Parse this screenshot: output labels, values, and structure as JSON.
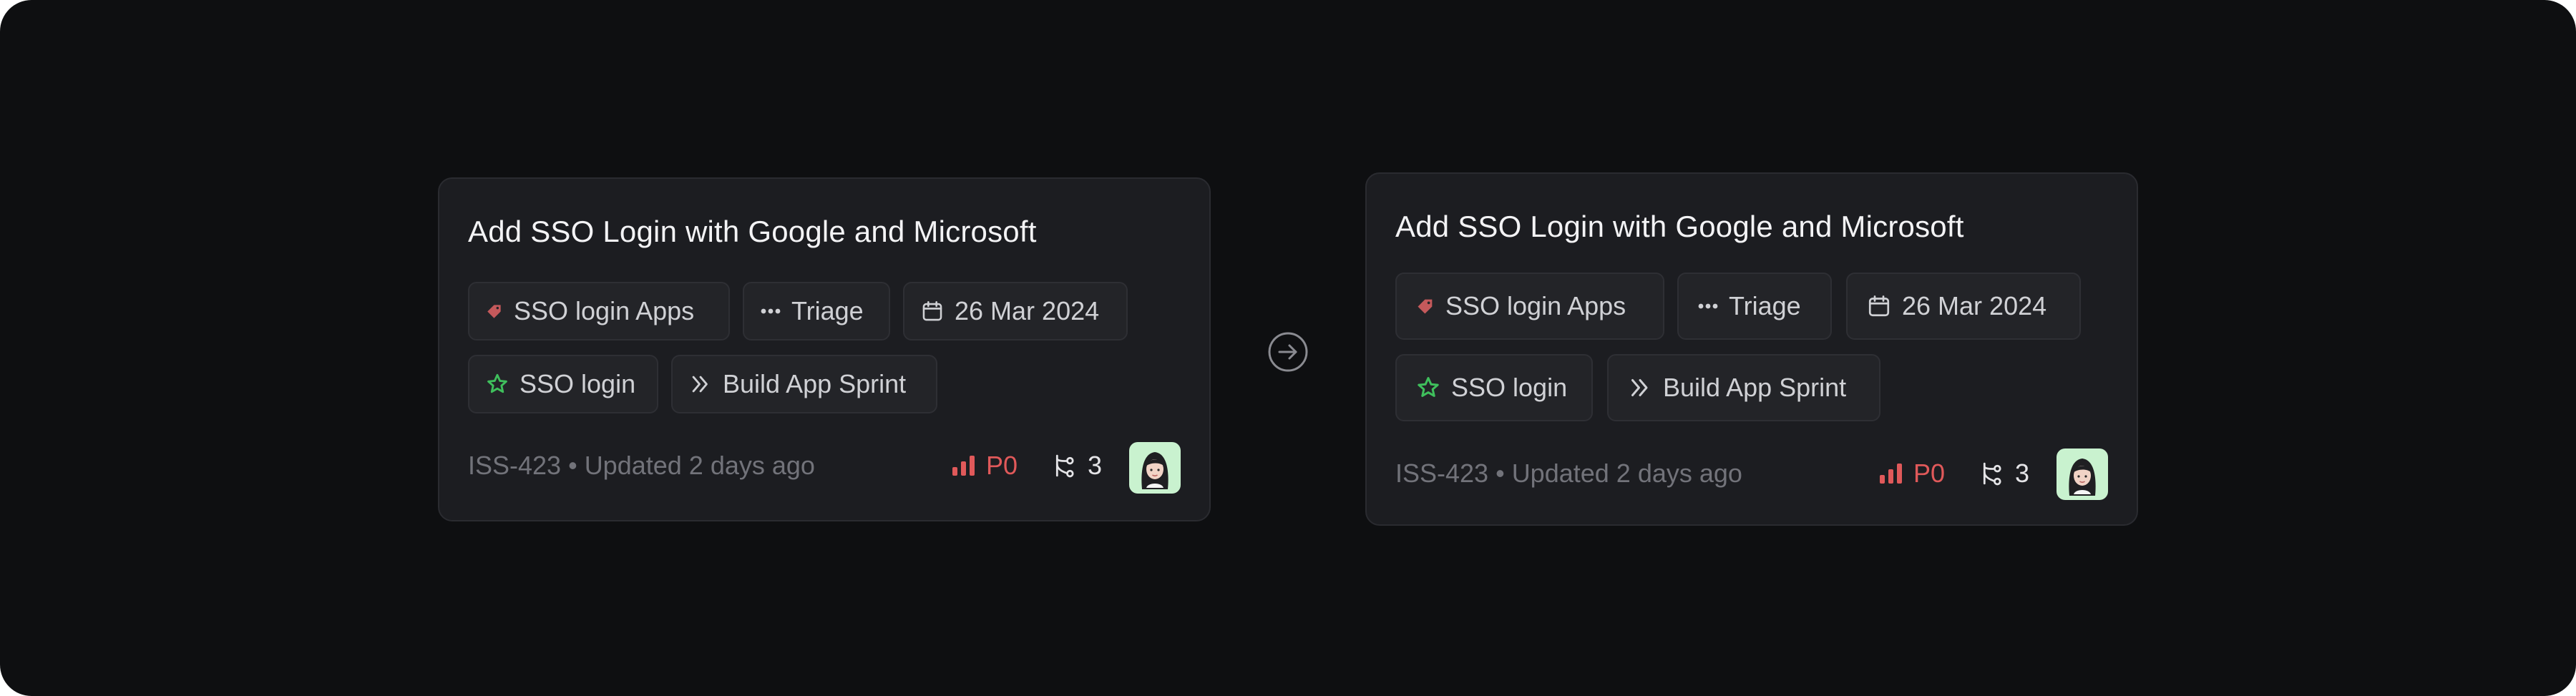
{
  "colors": {
    "background": "#0e0f11",
    "card": "#1c1d21",
    "chip": "#232428",
    "priority": "#e0595a",
    "label_tag": "#c4595b",
    "project_star": "#3fbf5c",
    "avatar_bg": "#c9f2cf"
  },
  "transition_icon": "arrow-right-circle-icon",
  "cards": [
    {
      "title": "Add SSO Login with Google and Microsoft",
      "label_icon": "tag-icon",
      "label": "SSO login Apps",
      "status_icon": "more-dots-icon",
      "status": "Triage",
      "date_icon": "calendar-icon",
      "date": "26 Mar 2024",
      "project_icon": "star-icon",
      "project": "SSO login",
      "sprint_icon": "chevrons-right-icon",
      "sprint": "Build App Sprint",
      "issue_id": "ISS-423",
      "separator": "•",
      "updated": "Updated 2 days ago",
      "priority_icon": "signal-bars-icon",
      "priority": "P0",
      "branch_icon": "git-branch-icon",
      "branch_count": "3",
      "avatar_icon": "avatar-icon"
    },
    {
      "title": "Add SSO Login with Google and Microsoft",
      "label_icon": "tag-icon",
      "label": "SSO login Apps",
      "status_icon": "more-dots-icon",
      "status": "Triage",
      "date_icon": "calendar-icon",
      "date": "26 Mar 2024",
      "project_icon": "star-icon",
      "project": "SSO login",
      "sprint_icon": "chevrons-right-icon",
      "sprint": "Build App Sprint",
      "issue_id": "ISS-423",
      "separator": "•",
      "updated": "Updated 2 days ago",
      "priority_icon": "signal-bars-icon",
      "priority": "P0",
      "branch_icon": "git-branch-icon",
      "branch_count": "3",
      "avatar_icon": "avatar-icon"
    }
  ]
}
